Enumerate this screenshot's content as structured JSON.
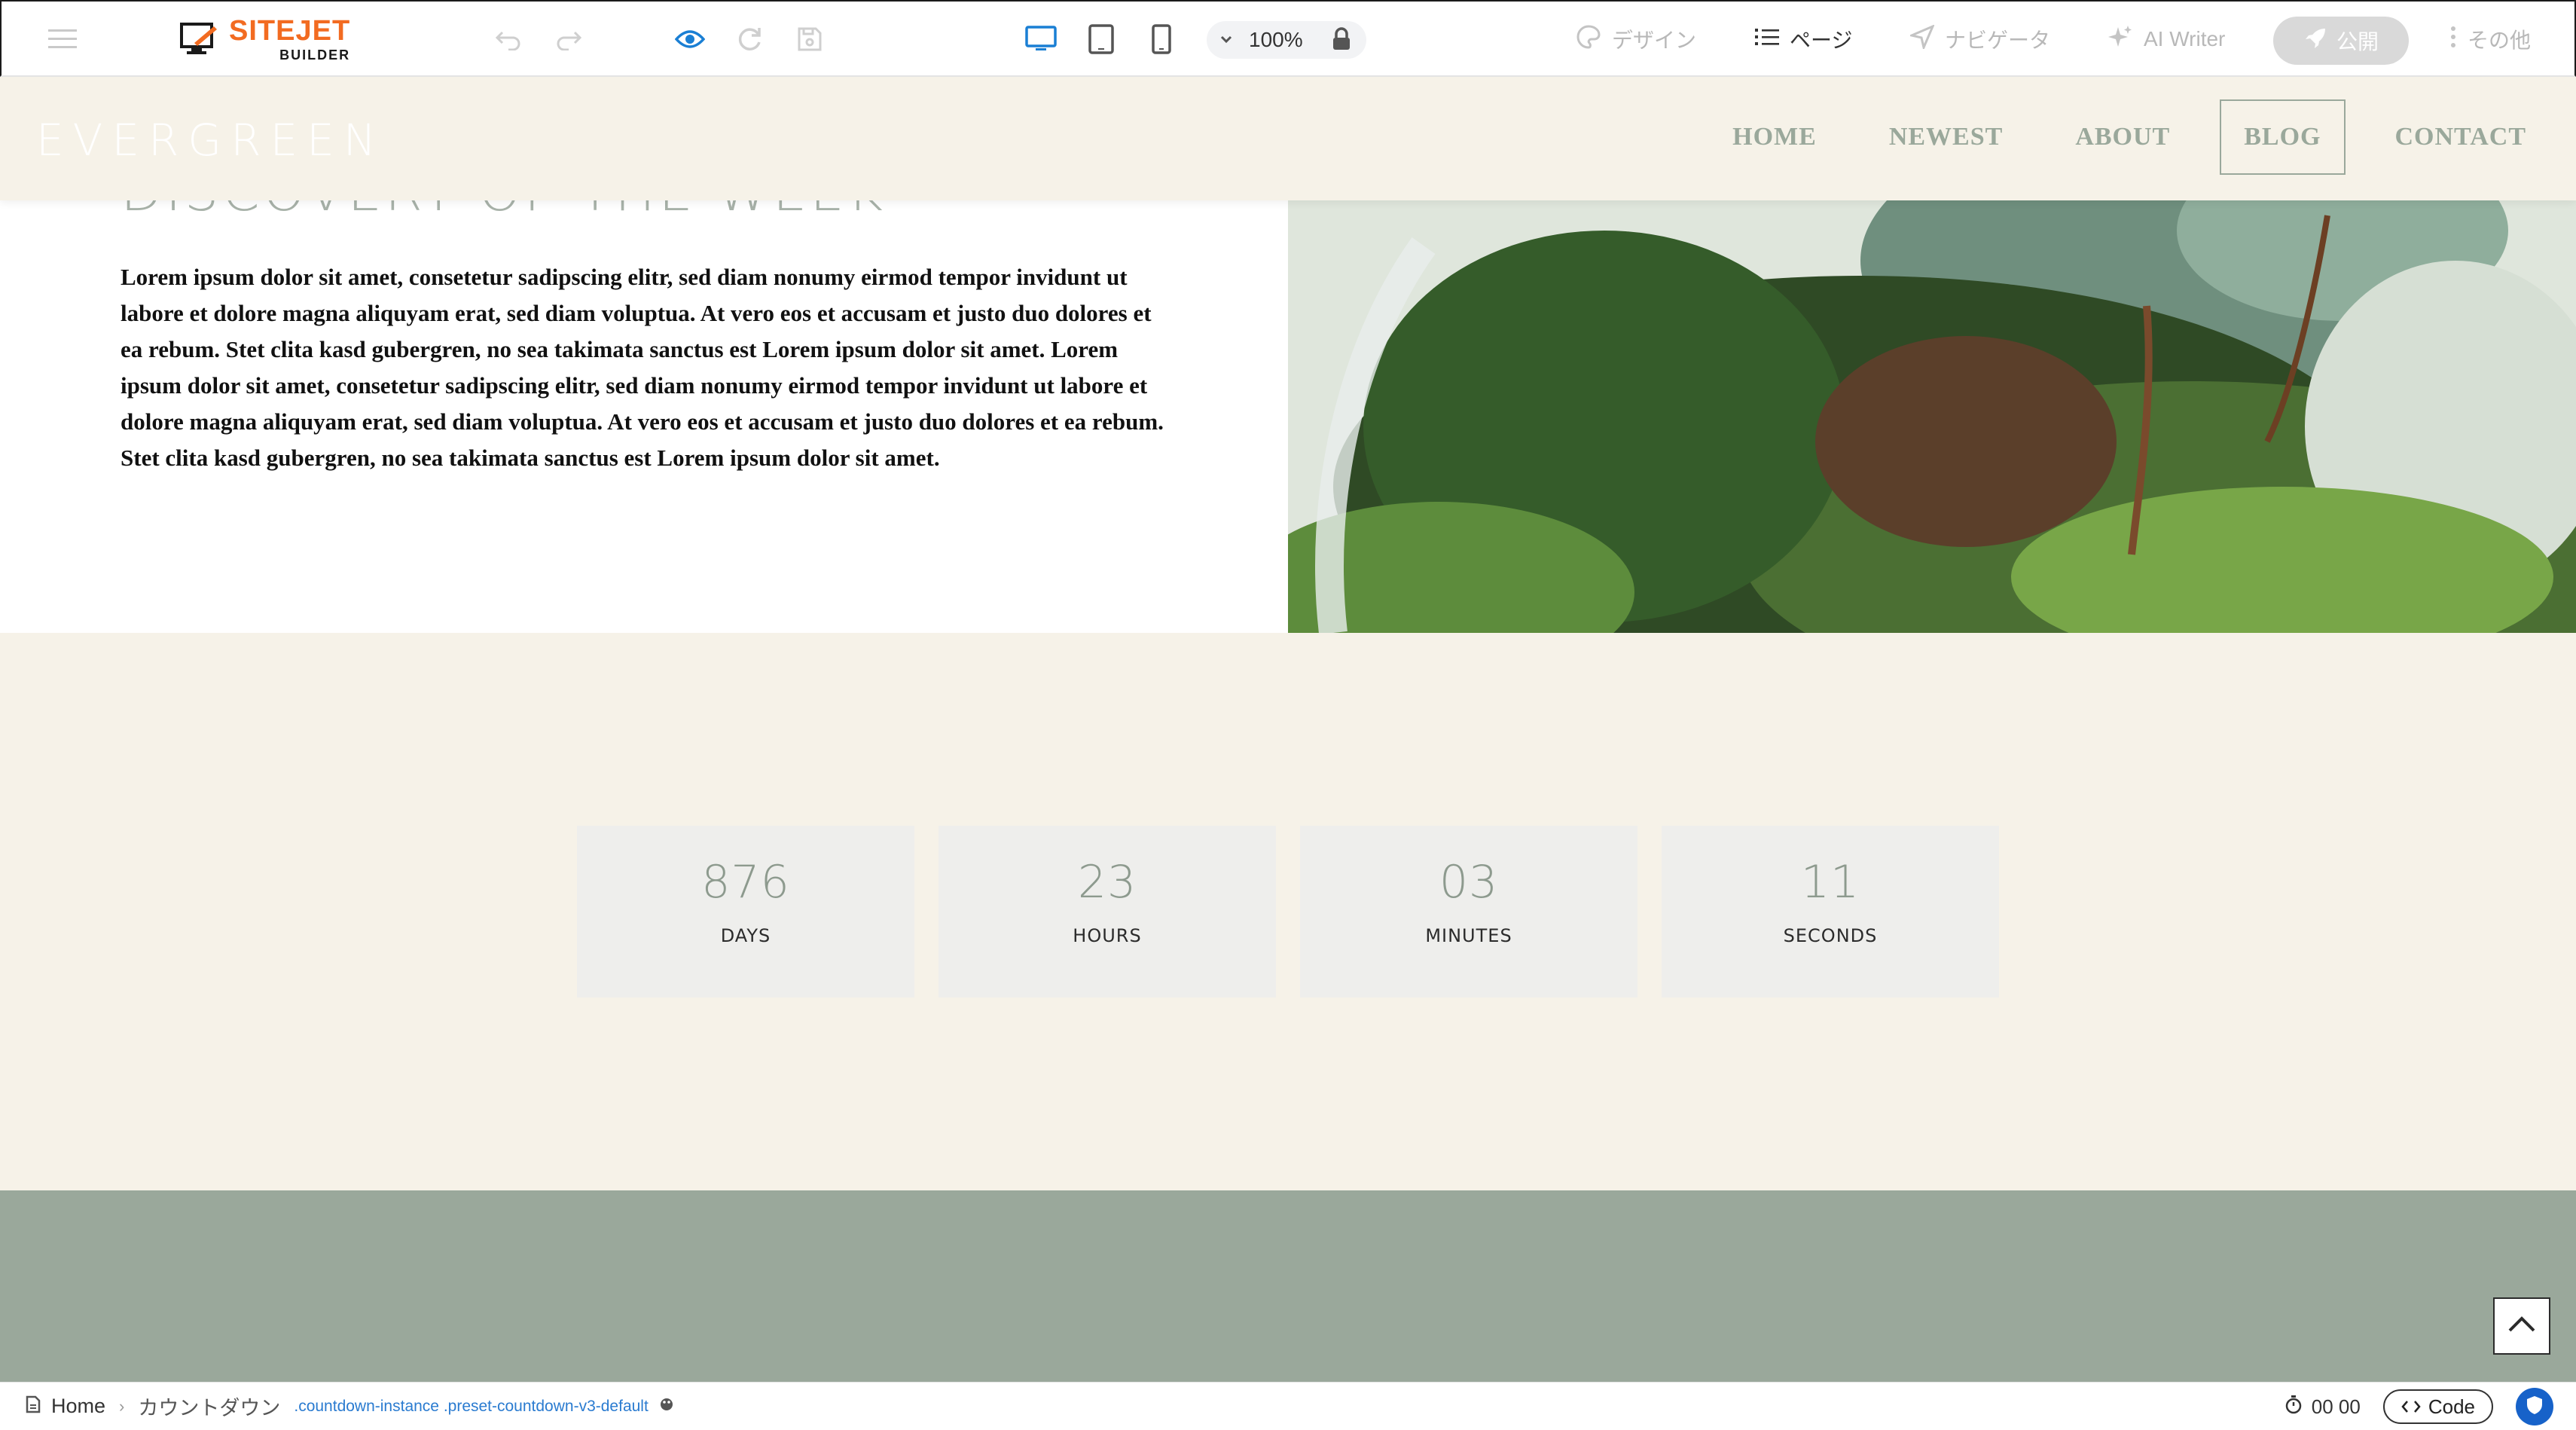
{
  "toolbar": {
    "logo_main": "SITEJET",
    "logo_sub": "BUILDER",
    "zoom": "100%",
    "design_label": "デザイン",
    "pages_label": "ページ",
    "navigator_label": "ナビゲータ",
    "ai_writer_label": "AI Writer",
    "publish_label": "公開",
    "more_label": "その他",
    "icons": [
      "menu-icon",
      "undo-icon",
      "redo-icon",
      "preview-eye-icon",
      "refresh-icon",
      "save-icon",
      "desktop-icon",
      "tablet-icon",
      "mobile-icon",
      "chevron-down-icon",
      "lock-icon",
      "palette-icon",
      "list-icon",
      "navigation-icon",
      "sparkle-icon",
      "rocket-icon",
      "more-vertical-icon"
    ],
    "accent_color": "#1a7fd4",
    "brand_color": "#f26b21"
  },
  "site": {
    "brand": "EVERGREEN",
    "nav": [
      "HOME",
      "NEWEST",
      "ABOUT",
      "BLOG",
      "CONTACT"
    ],
    "active_nav": "BLOG",
    "header_bg": "#f6f2e8",
    "accent_green": "#9aa89b"
  },
  "intro": {
    "title": "DISCOVERY OF THE WEEK",
    "body": "Lorem ipsum dolor sit amet, consetetur sadipscing elitr, sed diam nonumy eirmod tempor invidunt ut labore et dolore magna aliquyam erat, sed diam voluptua. At vero eos et accusam et justo duo dolores et ea rebum. Stet clita kasd gubergren, no sea takimata sanctus est Lorem ipsum dolor sit amet. Lorem ipsum dolor sit amet, consetetur sadipscing elitr, sed diam nonumy eirmod tempor invidunt ut labore et dolore magna aliquyam erat, sed diam voluptua. At vero eos et accusam et justo duo dolores et ea rebum. Stet clita kasd gubergren, no sea takimata sanctus est Lorem ipsum dolor sit amet."
  },
  "countdown": {
    "items": [
      {
        "value": "876",
        "label": "DAYS"
      },
      {
        "value": "23",
        "label": "HOURS"
      },
      {
        "value": "03",
        "label": "MINUTES"
      },
      {
        "value": "11",
        "label": "SECONDS"
      }
    ]
  },
  "statusbar": {
    "home": "Home",
    "element": "カウントダウン",
    "selector": ".countdown-instance .preset-countdown-v3-default",
    "time": "00 00",
    "code_label": "Code"
  }
}
